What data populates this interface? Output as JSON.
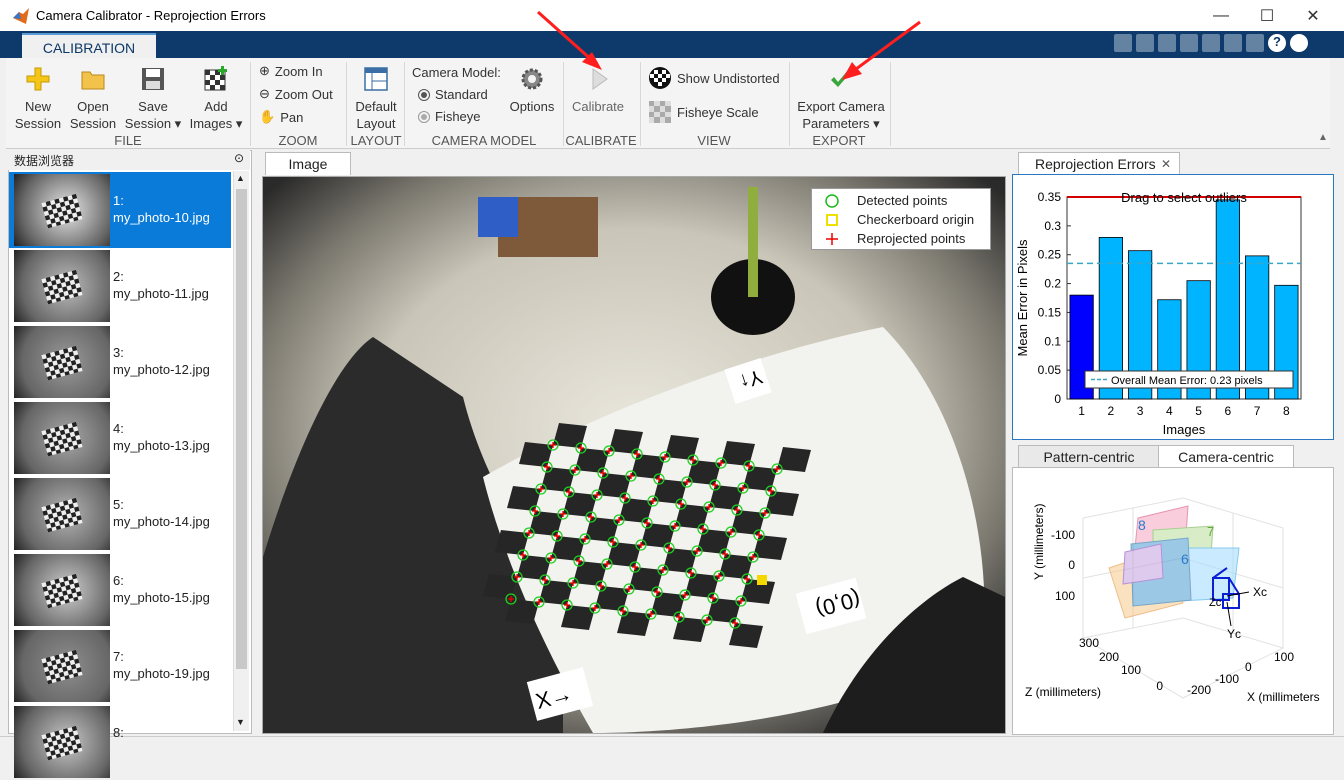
{
  "window": {
    "title": "Camera Calibrator - Reprojection Errors"
  },
  "ribbon": {
    "tab": "CALIBRATION",
    "file": {
      "group": "FILE",
      "new_session": [
        "New",
        "Session"
      ],
      "open_session": [
        "Open",
        "Session"
      ],
      "save_session": [
        "Save",
        "Session ▾"
      ],
      "add_images": [
        "Add",
        "Images ▾"
      ]
    },
    "zoom": {
      "group": "ZOOM",
      "zoom_in": "Zoom In",
      "zoom_out": "Zoom Out",
      "pan": "Pan"
    },
    "layout": {
      "group": "LAYOUT",
      "default_layout": [
        "Default",
        "Layout"
      ]
    },
    "camera_model": {
      "group": "CAMERA MODEL",
      "label": "Camera Model:",
      "standard": "Standard",
      "fisheye": "Fisheye",
      "options": "Options"
    },
    "calibrate": {
      "group": "CALIBRATE",
      "label": "Calibrate"
    },
    "view": {
      "group": "VIEW",
      "show_undistorted": "Show Undistorted",
      "fisheye_scale": "Fisheye Scale"
    },
    "export": {
      "group": "EXPORT",
      "label": [
        "Export Camera",
        "Parameters ▾"
      ]
    }
  },
  "data_browser": {
    "title": "数据浏览器",
    "items": [
      {
        "index": "1:",
        "name": "my_photo-10.jpg"
      },
      {
        "index": "2:",
        "name": "my_photo-11.jpg"
      },
      {
        "index": "3:",
        "name": "my_photo-12.jpg"
      },
      {
        "index": "4:",
        "name": "my_photo-13.jpg"
      },
      {
        "index": "5:",
        "name": "my_photo-14.jpg"
      },
      {
        "index": "6:",
        "name": "my_photo-15.jpg"
      },
      {
        "index": "7:",
        "name": "my_photo-19.jpg"
      },
      {
        "index": "8:",
        "name": ""
      }
    ]
  },
  "image_panel": {
    "tab": "Image",
    "legend": [
      "Detected points",
      "Checkerboard origin",
      "Reprojected points"
    ],
    "labels": {
      "y": "Y↑",
      "origin": "(0,0)",
      "x": "X→"
    }
  },
  "reproj_panel": {
    "tab": "Reprojection Errors",
    "hint": "Drag to select outliers"
  },
  "extrinsics": {
    "tabs": [
      "Pattern-centric",
      "Camera-centric"
    ],
    "ylabel": "Y (millimeters)",
    "zlabel": "Z (millimeters)",
    "xlabel": "X (millimeters",
    "yticks": [
      "-100",
      "0",
      "100"
    ],
    "zticks": [
      "300",
      "200",
      "100",
      "0"
    ],
    "xticks": [
      "-200",
      "-100",
      "0",
      "100"
    ],
    "xc": "Xc",
    "yc": "Yc",
    "zc": "Zc"
  },
  "chart_data": {
    "type": "bar",
    "categories": [
      "1",
      "2",
      "3",
      "4",
      "5",
      "6",
      "7",
      "8"
    ],
    "values": [
      0.18,
      0.28,
      0.257,
      0.172,
      0.205,
      0.345,
      0.248,
      0.197
    ],
    "selected_index": 0,
    "mean": 0.235,
    "legend": "Overall Mean Error: 0.23 pixels",
    "xlabel": "Images",
    "ylabel": "Mean Error in Pixels",
    "ylim": [
      0,
      0.35
    ],
    "yticks": [
      "0",
      "0.05",
      "0.1",
      "0.15",
      "0.2",
      "0.25",
      "0.3",
      "0.35"
    ],
    "colors": {
      "bar": "#00b4ff",
      "selected": "#0000ff",
      "mean": "#3aa6c8",
      "threshold": "#d40000"
    }
  }
}
